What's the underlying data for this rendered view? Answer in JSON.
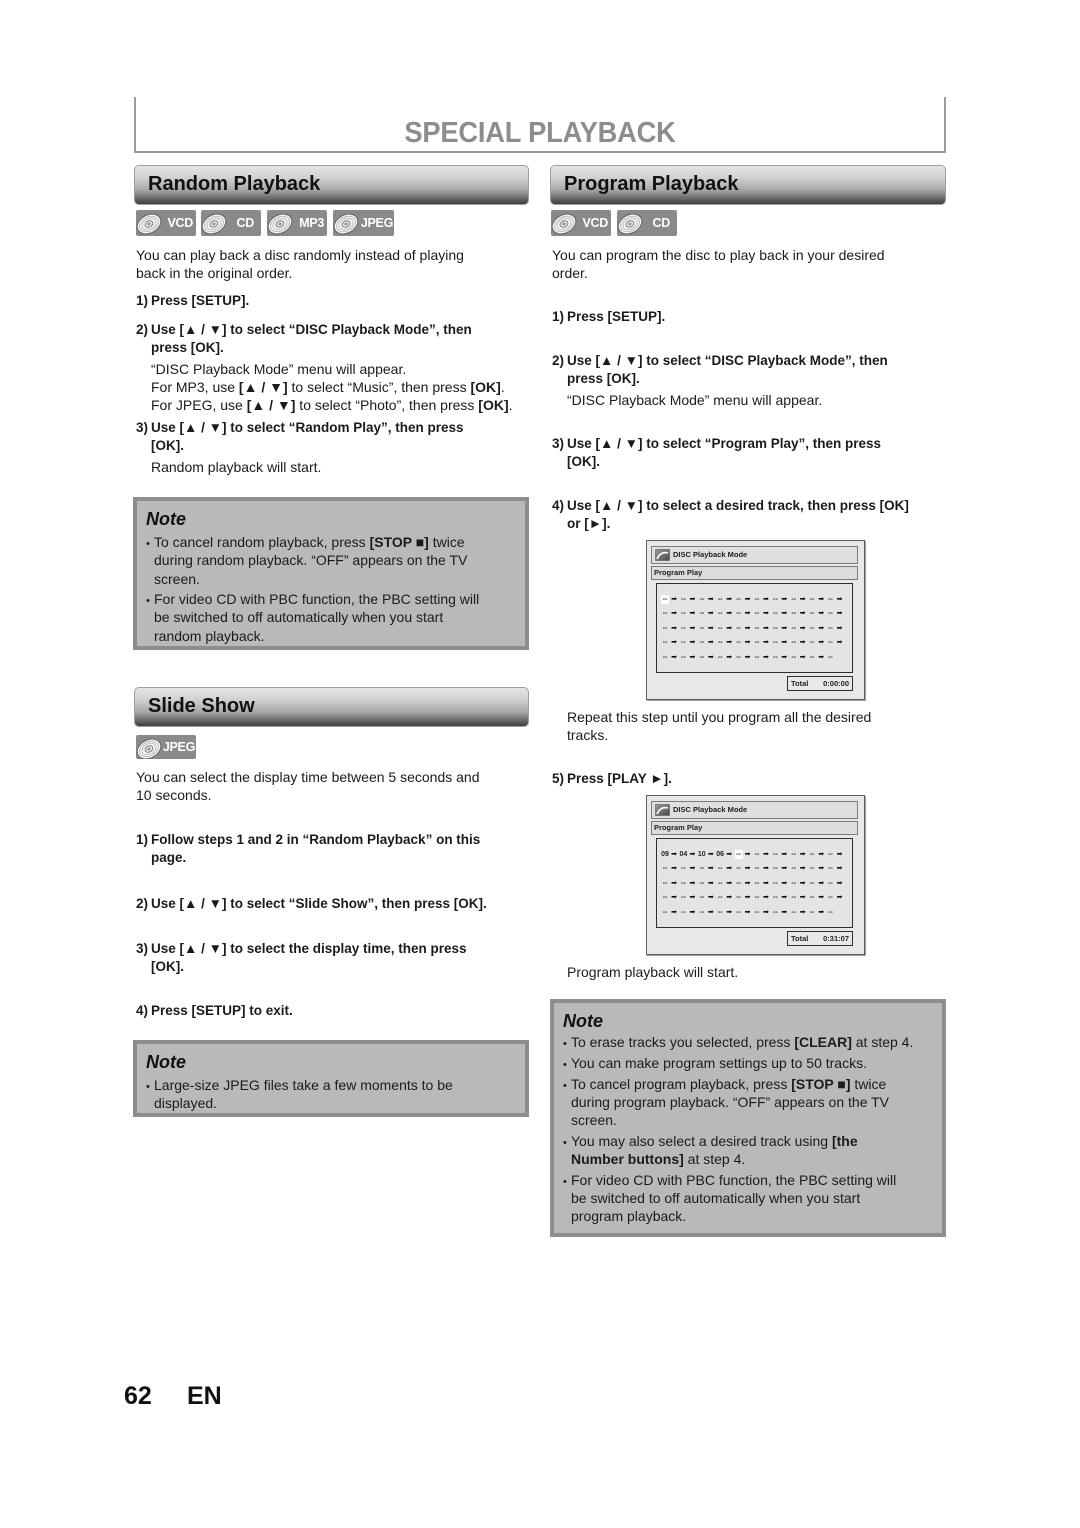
{
  "page": {
    "title": "SPECIAL PLAYBACK",
    "page_number": "62",
    "language": "EN"
  },
  "random": {
    "heading": "Random Playback",
    "badges": [
      {
        "label": "VCD",
        "icon": "disc-icon"
      },
      {
        "label": "CD",
        "icon": "disc-icon"
      },
      {
        "label": "MP3",
        "icon": "disc-icon"
      },
      {
        "label": "JPEG",
        "icon": "disc-icon"
      }
    ],
    "intro": "You can play back a disc randomly instead of playing back in the original order.",
    "steps": [
      {
        "num": "1)",
        "text": "Press [SETUP]."
      },
      {
        "num": "2)",
        "text": "Use [▲ / ▼] to select “DISC Playback Mode”, then press [OK].",
        "details": [
          [
            {
              "text": "“DISC Playback Mode” menu will appear."
            }
          ],
          [
            {
              "text": "For MP3, use "
            },
            {
              "text": "[▲ / ▼]",
              "bold": true
            },
            {
              "text": " to select “Music”, then press "
            },
            {
              "text": "[OK]",
              "bold": true
            },
            {
              "text": "."
            }
          ],
          [
            {
              "text": "For JPEG, use "
            },
            {
              "text": "[▲ / ▼]",
              "bold": true
            },
            {
              "text": " to select “Photo”, then press "
            },
            {
              "text": "[OK]",
              "bold": true
            },
            {
              "text": "."
            }
          ]
        ]
      },
      {
        "num": "3)",
        "text": "Use [▲ / ▼] to select “Random Play”, then press [OK].",
        "details": [
          [
            {
              "text": "Random playback will start."
            }
          ]
        ]
      }
    ],
    "note": {
      "title": "Note",
      "items": [
        [
          {
            "text": "To cancel random playback, press "
          },
          {
            "text": "[STOP ■]",
            "bold": true
          },
          {
            "text": " twice during random playback. “OFF” appears on the TV screen."
          }
        ],
        [
          {
            "text": "For video CD with PBC function, the PBC setting will be switched to off automatically when you start random playback."
          }
        ]
      ]
    }
  },
  "slide_show": {
    "heading": "Slide Show",
    "badges": [
      {
        "label": "JPEG",
        "icon": "disc-icon"
      }
    ],
    "intro": "You can select the display time between 5 seconds and 10 seconds.",
    "steps": [
      {
        "num": "1)",
        "text": "Follow steps 1 and 2 in “Random Playback” on this page."
      },
      {
        "num": "2)",
        "text": "Use [▲ / ▼] to select “Slide Show”, then press [OK]."
      },
      {
        "num": "3)",
        "text": "Use [▲ / ▼] to select the display time, then press [OK]."
      },
      {
        "num": "4)",
        "text": "Press [SETUP] to exit."
      }
    ],
    "note": {
      "title": "Note",
      "items": [
        [
          {
            "text": "Large-size JPEG files take a few moments to be displayed."
          }
        ]
      ]
    }
  },
  "program": {
    "heading": "Program Playback",
    "badges": [
      {
        "label": "VCD",
        "icon": "disc-icon"
      },
      {
        "label": "CD",
        "icon": "disc-icon"
      }
    ],
    "intro": "You can program the disc to play back in your desired order.",
    "steps": [
      {
        "num": "1)",
        "text": "Press [SETUP]."
      },
      {
        "num": "2)",
        "text": "Use [▲ / ▼] to select “DISC Playback Mode”, then press [OK].",
        "details": [
          [
            {
              "text": "“DISC Playback Mode” menu will appear."
            }
          ]
        ]
      },
      {
        "num": "3)",
        "text": "Use [▲ / ▼] to select “Program Play”, then press [OK]."
      },
      {
        "num": "4)",
        "text": "Use [▲ / ▼] to select a desired track, then press [OK] or [►].",
        "details": [
          [
            {
              "text": "Repeat this step until you program all the desired tracks."
            }
          ]
        ]
      },
      {
        "num": "5)",
        "text": "Press [PLAY ►].",
        "details": [
          [
            {
              "text": "Program playback will start."
            }
          ]
        ]
      }
    ],
    "screens": [
      {
        "title": "DISC Playback Mode",
        "subtitle": "Program Play",
        "selected_index": 0,
        "total_label": "Total",
        "total_time": "0:00:00",
        "tracks": [
          "--",
          "--",
          "--",
          "--",
          "--",
          "--",
          "--",
          "--",
          "--",
          "--",
          "--",
          "--",
          "--",
          "--",
          "--",
          "--",
          "--",
          "--",
          "--",
          "--",
          "--",
          "--",
          "--",
          "--",
          "--",
          "--",
          "--",
          "--",
          "--",
          "--",
          "--",
          "--",
          "--",
          "--",
          "--",
          "--",
          "--",
          "--",
          "--",
          "--",
          "--",
          "--",
          "--",
          "--",
          "--",
          "--",
          "--",
          "--",
          "--",
          "--"
        ]
      },
      {
        "title": "DISC Playback Mode",
        "subtitle": "Program Play",
        "selected_index": 4,
        "total_label": "Total",
        "total_time": "0:31:07",
        "tracks": [
          "09",
          "04",
          "10",
          "06",
          "--",
          "--",
          "--",
          "--",
          "--",
          "--",
          "--",
          "--",
          "--",
          "--",
          "--",
          "--",
          "--",
          "--",
          "--",
          "--",
          "--",
          "--",
          "--",
          "--",
          "--",
          "--",
          "--",
          "--",
          "--",
          "--",
          "--",
          "--",
          "--",
          "--",
          "--",
          "--",
          "--",
          "--",
          "--",
          "--",
          "--",
          "--",
          "--",
          "--",
          "--",
          "--",
          "--",
          "--",
          "--",
          "--"
        ]
      }
    ],
    "note": {
      "title": "Note",
      "items": [
        [
          {
            "text": "To erase tracks you selected, press "
          },
          {
            "text": "[CLEAR]",
            "bold": true
          },
          {
            "text": " at step 4."
          }
        ],
        [
          {
            "text": "You can make program settings up to 50 tracks."
          }
        ],
        [
          {
            "text": "To cancel program playback, press "
          },
          {
            "text": "[STOP ■]",
            "bold": true
          },
          {
            "text": " twice during program playback. “OFF” appears on the TV screen."
          }
        ],
        [
          {
            "text": "You may also select a desired track using "
          },
          {
            "text": "[the Number buttons]",
            "bold": true
          },
          {
            "text": " at step 4."
          }
        ],
        [
          {
            "text": "For video CD with PBC function, the PBC setting will be switched to off automatically when you start program playback."
          }
        ]
      ]
    }
  }
}
